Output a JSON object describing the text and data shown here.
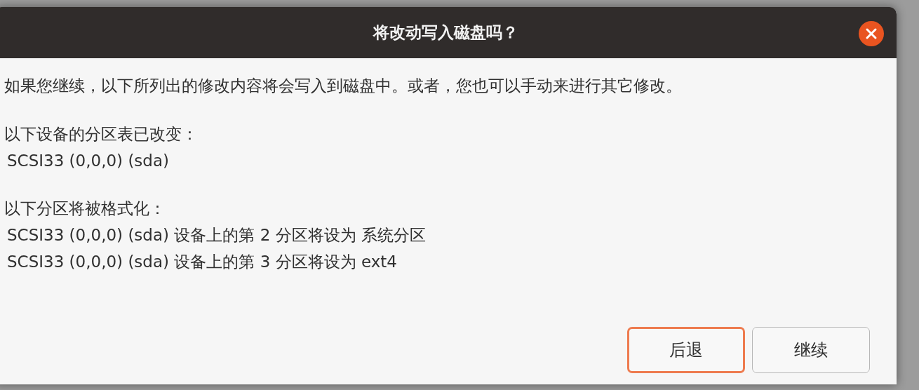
{
  "window": {
    "title": "将改动写入磁盘吗？"
  },
  "message": "如果您继续，以下所列出的修改内容将会写入到磁盘中。或者，您也可以手动来进行其它修改。",
  "sections": [
    {
      "heading": "以下设备的分区表已改变：",
      "items": [
        "SCSI33 (0,0,0) (sda)"
      ]
    },
    {
      "heading": "以下分区将被格式化：",
      "items": [
        "SCSI33 (0,0,0) (sda) 设备上的第 2 分区将设为 系统分区",
        "SCSI33 (0,0,0) (sda) 设备上的第 3 分区将设为 ext4"
      ]
    }
  ],
  "buttons": [
    {
      "label": "后退",
      "focused": true
    },
    {
      "label": "继续",
      "focused": false
    }
  ]
}
